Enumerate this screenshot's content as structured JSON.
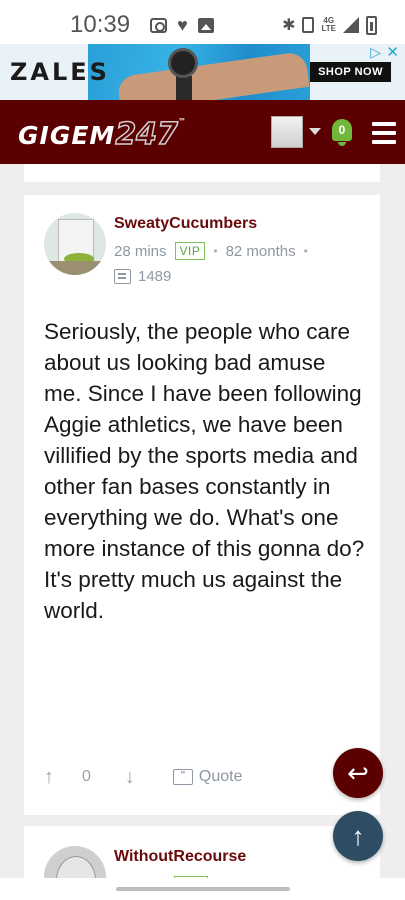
{
  "status_bar": {
    "time": "10:39",
    "network": "4G",
    "network_sub": "LTE"
  },
  "ad": {
    "brand": "ZALES",
    "cta": "SHOP NOW",
    "choices_icon": "ad-choices-icon",
    "close_icon": "close-icon"
  },
  "header": {
    "logo_text": "GIGEM",
    "logo_number": "247",
    "logo_tm": "™",
    "notification_count": "0"
  },
  "post": {
    "username": "SweatyCucumbers",
    "time_ago": "28 mins",
    "badge": "VIP",
    "tenure": "82 months",
    "post_count": "1489",
    "body": "Seriously, the people who care about us looking bad amuse me. Since I have been following Aggie athletics, we have been villified by the sports media and other fan bases constantly in everything we do. What's one more instance of this gonna do? It's pretty much us against the world.",
    "vote_count": "0",
    "quote_label": "Quote"
  },
  "next_post": {
    "username": "WithoutRecourse"
  },
  "colors": {
    "brand": "#5b0000",
    "username": "#6a0a0a",
    "vip": "#5aa53a",
    "scroll_top_button": "#2c4d63"
  }
}
